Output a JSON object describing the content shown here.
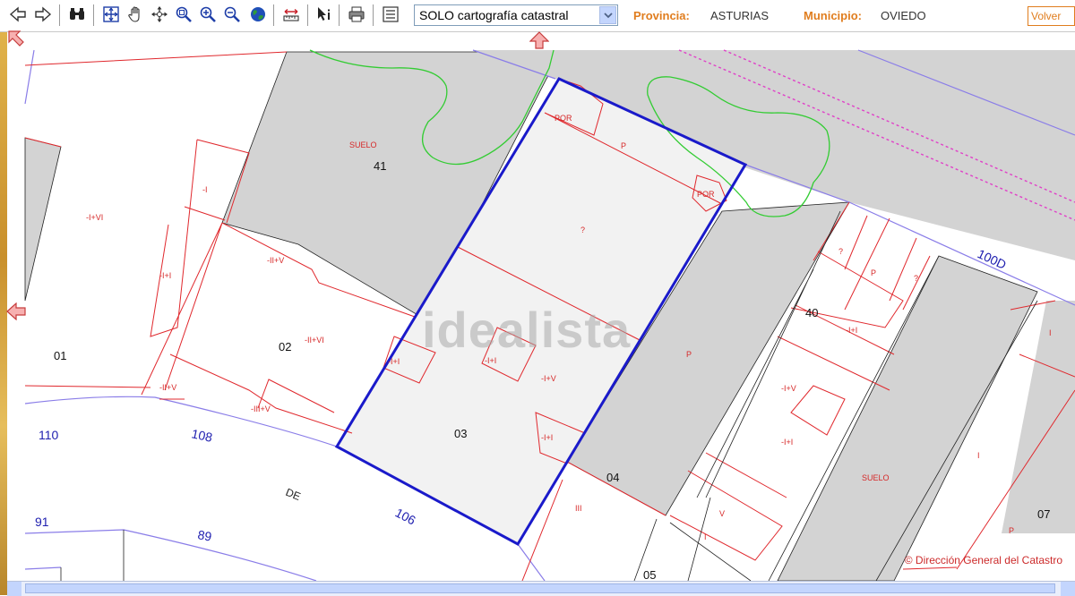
{
  "toolbar": {
    "layer_select": {
      "value": "SOLO cartografía catastral"
    },
    "provincia_label": "Provincia:",
    "provincia_value": "ASTURIAS",
    "municipio_label": "Municipio:",
    "municipio_value": "OVIEDO",
    "back_label": "Volver"
  },
  "map": {
    "parcels": {
      "p01": "01",
      "p02": "02",
      "p03": "03",
      "p04": "04",
      "p05": "05",
      "p07": "07",
      "p40": "40",
      "p41": "41"
    },
    "subparcels": {
      "a": "-I+VI",
      "b": "-I",
      "c": "-I+I",
      "d": "-II+V",
      "e": "-II+VI",
      "f": "-II+V",
      "g": "-III+V",
      "h": "-I+I",
      "i": "-I+I",
      "j": "-I+V",
      "k": "-I+I",
      "l": "III",
      "m": "?",
      "n": "P",
      "o": "POR",
      "p": "POR",
      "q": "P",
      "r": "?",
      "s": "P",
      "t": "?",
      "u": "-I+I",
      "v": "-I+V",
      "w": "-I+I",
      "x": "V",
      "y": "I",
      "z": "I",
      "aa": "P",
      "ab": "I",
      "suelo_1": "SUELO",
      "suelo_2": "SUELO"
    },
    "streets": {
      "s110": "110",
      "s108": "108",
      "s106": "106",
      "s91": "91",
      "s89": "89",
      "s100d": "100D",
      "de": "DE"
    },
    "watermark": "idealista",
    "copyright": "© Dirección General del Catastro"
  },
  "colors": {
    "accent": "#e07d1e",
    "parcel_line": "#e0282d",
    "selection": "#1a1aca",
    "street_line": "#8a7de8",
    "contour": "#33cc33",
    "rail": "#e040c8",
    "built_block": "#d3d3d3",
    "parcel_fill": "#f2f2f2"
  }
}
